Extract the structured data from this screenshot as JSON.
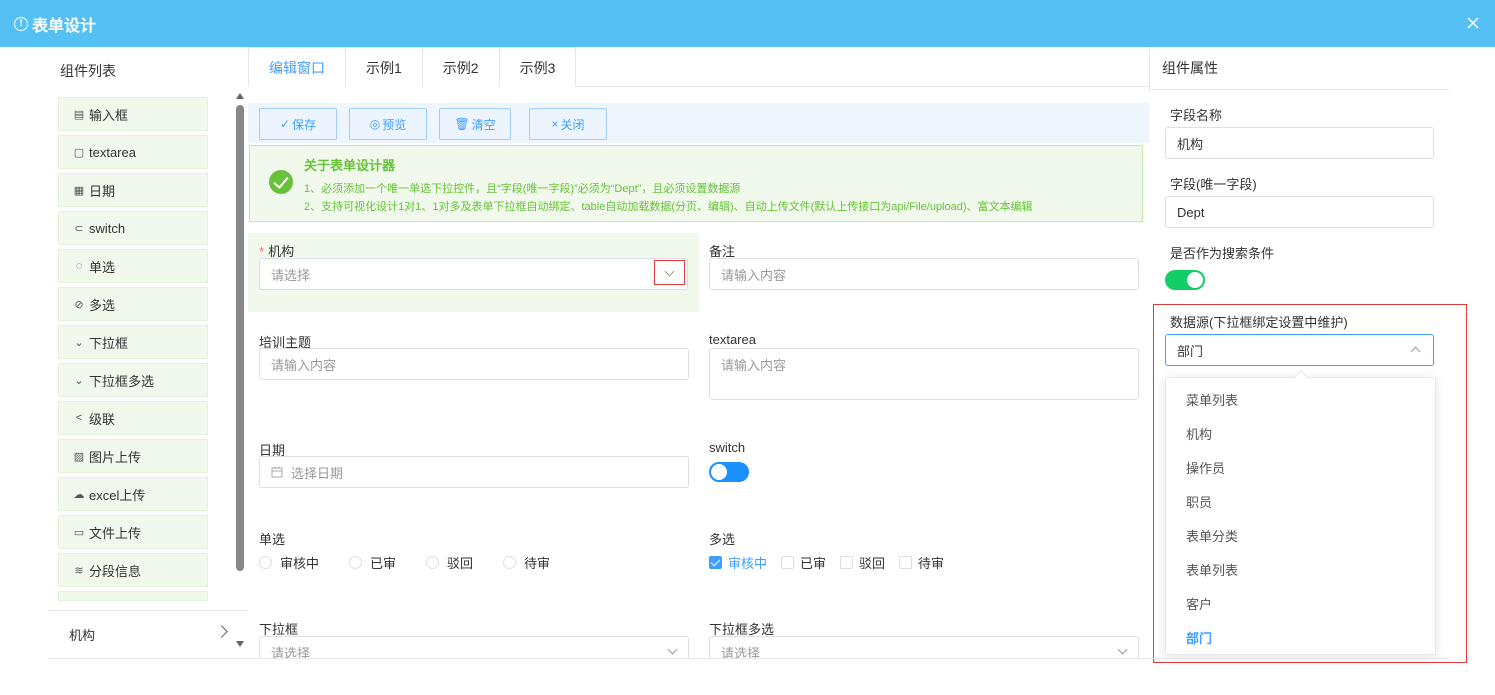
{
  "header": {
    "title": "表单设计"
  },
  "left": {
    "title": "组件列表",
    "items": [
      {
        "label": "输入框",
        "icon": "document-icon"
      },
      {
        "label": "textarea",
        "icon": "textarea-icon"
      },
      {
        "label": "日期",
        "icon": "calendar-icon"
      },
      {
        "label": "switch",
        "icon": "switch-icon"
      },
      {
        "label": "单选",
        "icon": "radio-icon"
      },
      {
        "label": "多选",
        "icon": "check-circle-icon"
      },
      {
        "label": "下拉框",
        "icon": "chevron-down-icon"
      },
      {
        "label": "下拉框多选",
        "icon": "chevron-down-icon"
      },
      {
        "label": "级联",
        "icon": "share-icon"
      },
      {
        "label": "图片上传",
        "icon": "image-icon"
      },
      {
        "label": "excel上传",
        "icon": "cloud-upload-icon"
      },
      {
        "label": "文件上传",
        "icon": "folder-icon"
      },
      {
        "label": "分段信息",
        "icon": "stack-icon"
      }
    ],
    "footer": "机构"
  },
  "tabs": [
    "编辑窗口",
    "示例1",
    "示例2",
    "示例3"
  ],
  "toolbar": {
    "save": "保存",
    "preview": "预览",
    "clear": "清空",
    "close": "关闭"
  },
  "notice": {
    "title": "关于表单设计器",
    "line1": "1、必须添加一个唯一单选下拉控件，且“字段(唯一字段)”必须为“Dept”，且必须设置数据源",
    "line2": "2、支持可视化设计1对1、1对多及表单下拉框自动绑定、table自动加载数据(分页、编辑)、自动上传文件(默认上传接口为api/File/upload)、富文本编辑"
  },
  "form": {
    "org_label": "机构",
    "org_placeholder": "请选择",
    "remark_label": "备注",
    "remark_placeholder": "请输入内容",
    "topic_label": "培训主题",
    "topic_placeholder": "请输入内容",
    "textarea_label": "textarea",
    "textarea_placeholder": "请输入内容",
    "date_label": "日期",
    "date_placeholder": "选择日期",
    "switch_label": "switch",
    "radio_label": "单选",
    "radio_options": [
      "审核中",
      "已审",
      "驳回",
      "待审"
    ],
    "check_label": "多选",
    "check_options": [
      "审核中",
      "已审",
      "驳回",
      "待审"
    ],
    "select_label": "下拉框",
    "select_placeholder": "请选择",
    "multiselect_label": "下拉框多选",
    "multiselect_placeholder": "请选择"
  },
  "right": {
    "title": "组件属性",
    "field_name_label": "字段名称",
    "field_name_value": "机构",
    "field_key_label": "字段(唯一字段)",
    "field_key_value": "Dept",
    "search_label": "是否作为搜索条件",
    "ds_label": "数据源(下拉框绑定设置中维护)",
    "ds_value": "部门",
    "ds_options": [
      "菜单列表",
      "机构",
      "操作员",
      "职员",
      "表单分类",
      "表单列表",
      "客户",
      "部门"
    ]
  },
  "colors": {
    "header": "#54c0f3",
    "accent": "#409eff",
    "success": "#67c23a",
    "highlight": "#e0393e"
  }
}
